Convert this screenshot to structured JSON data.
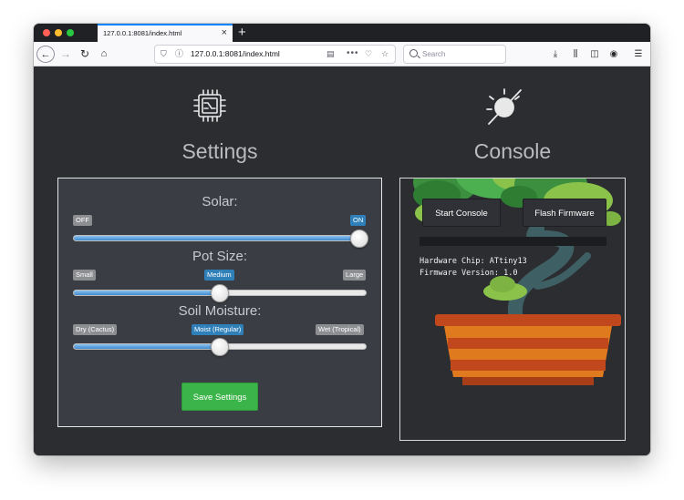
{
  "browser": {
    "tab_title": "127.0.0.1:8081/index.html",
    "tab_close": "×",
    "new_tab": "+",
    "url": "127.0.0.1:8081/index.html",
    "search_placeholder": "Search"
  },
  "settings": {
    "heading": "Settings",
    "save_label": "Save Settings",
    "sliders": [
      {
        "title": "Solar:",
        "labels": [
          "OFF",
          "ON"
        ],
        "active_label": "ON",
        "value": 1.0
      },
      {
        "title": "Pot Size:",
        "labels": [
          "Small",
          "Medium",
          "Large"
        ],
        "active_label": "Medium",
        "value": 0.5
      },
      {
        "title": "Soil Moisture:",
        "labels": [
          "Dry (Cactus)",
          "Moist (Regular)",
          "Wet (Tropical)"
        ],
        "active_label": "Moist (Regular)",
        "value": 0.5
      }
    ]
  },
  "console": {
    "heading": "Console",
    "start_label": "Start Console",
    "flash_label": "Flash Firmware",
    "output_lines": [
      "Hardware Chip: ATtiny13",
      "Firmware Version: 1.0"
    ]
  },
  "colors": {
    "page_bg": "#2b2d31",
    "panel_bg": "#3a3d44",
    "active_badge": "#2f7fb8",
    "save_button": "#3bb54a",
    "slider_fill": "#3f8ad0"
  },
  "icons": {
    "settings": "chip-icon",
    "console": "sun-off-icon"
  }
}
